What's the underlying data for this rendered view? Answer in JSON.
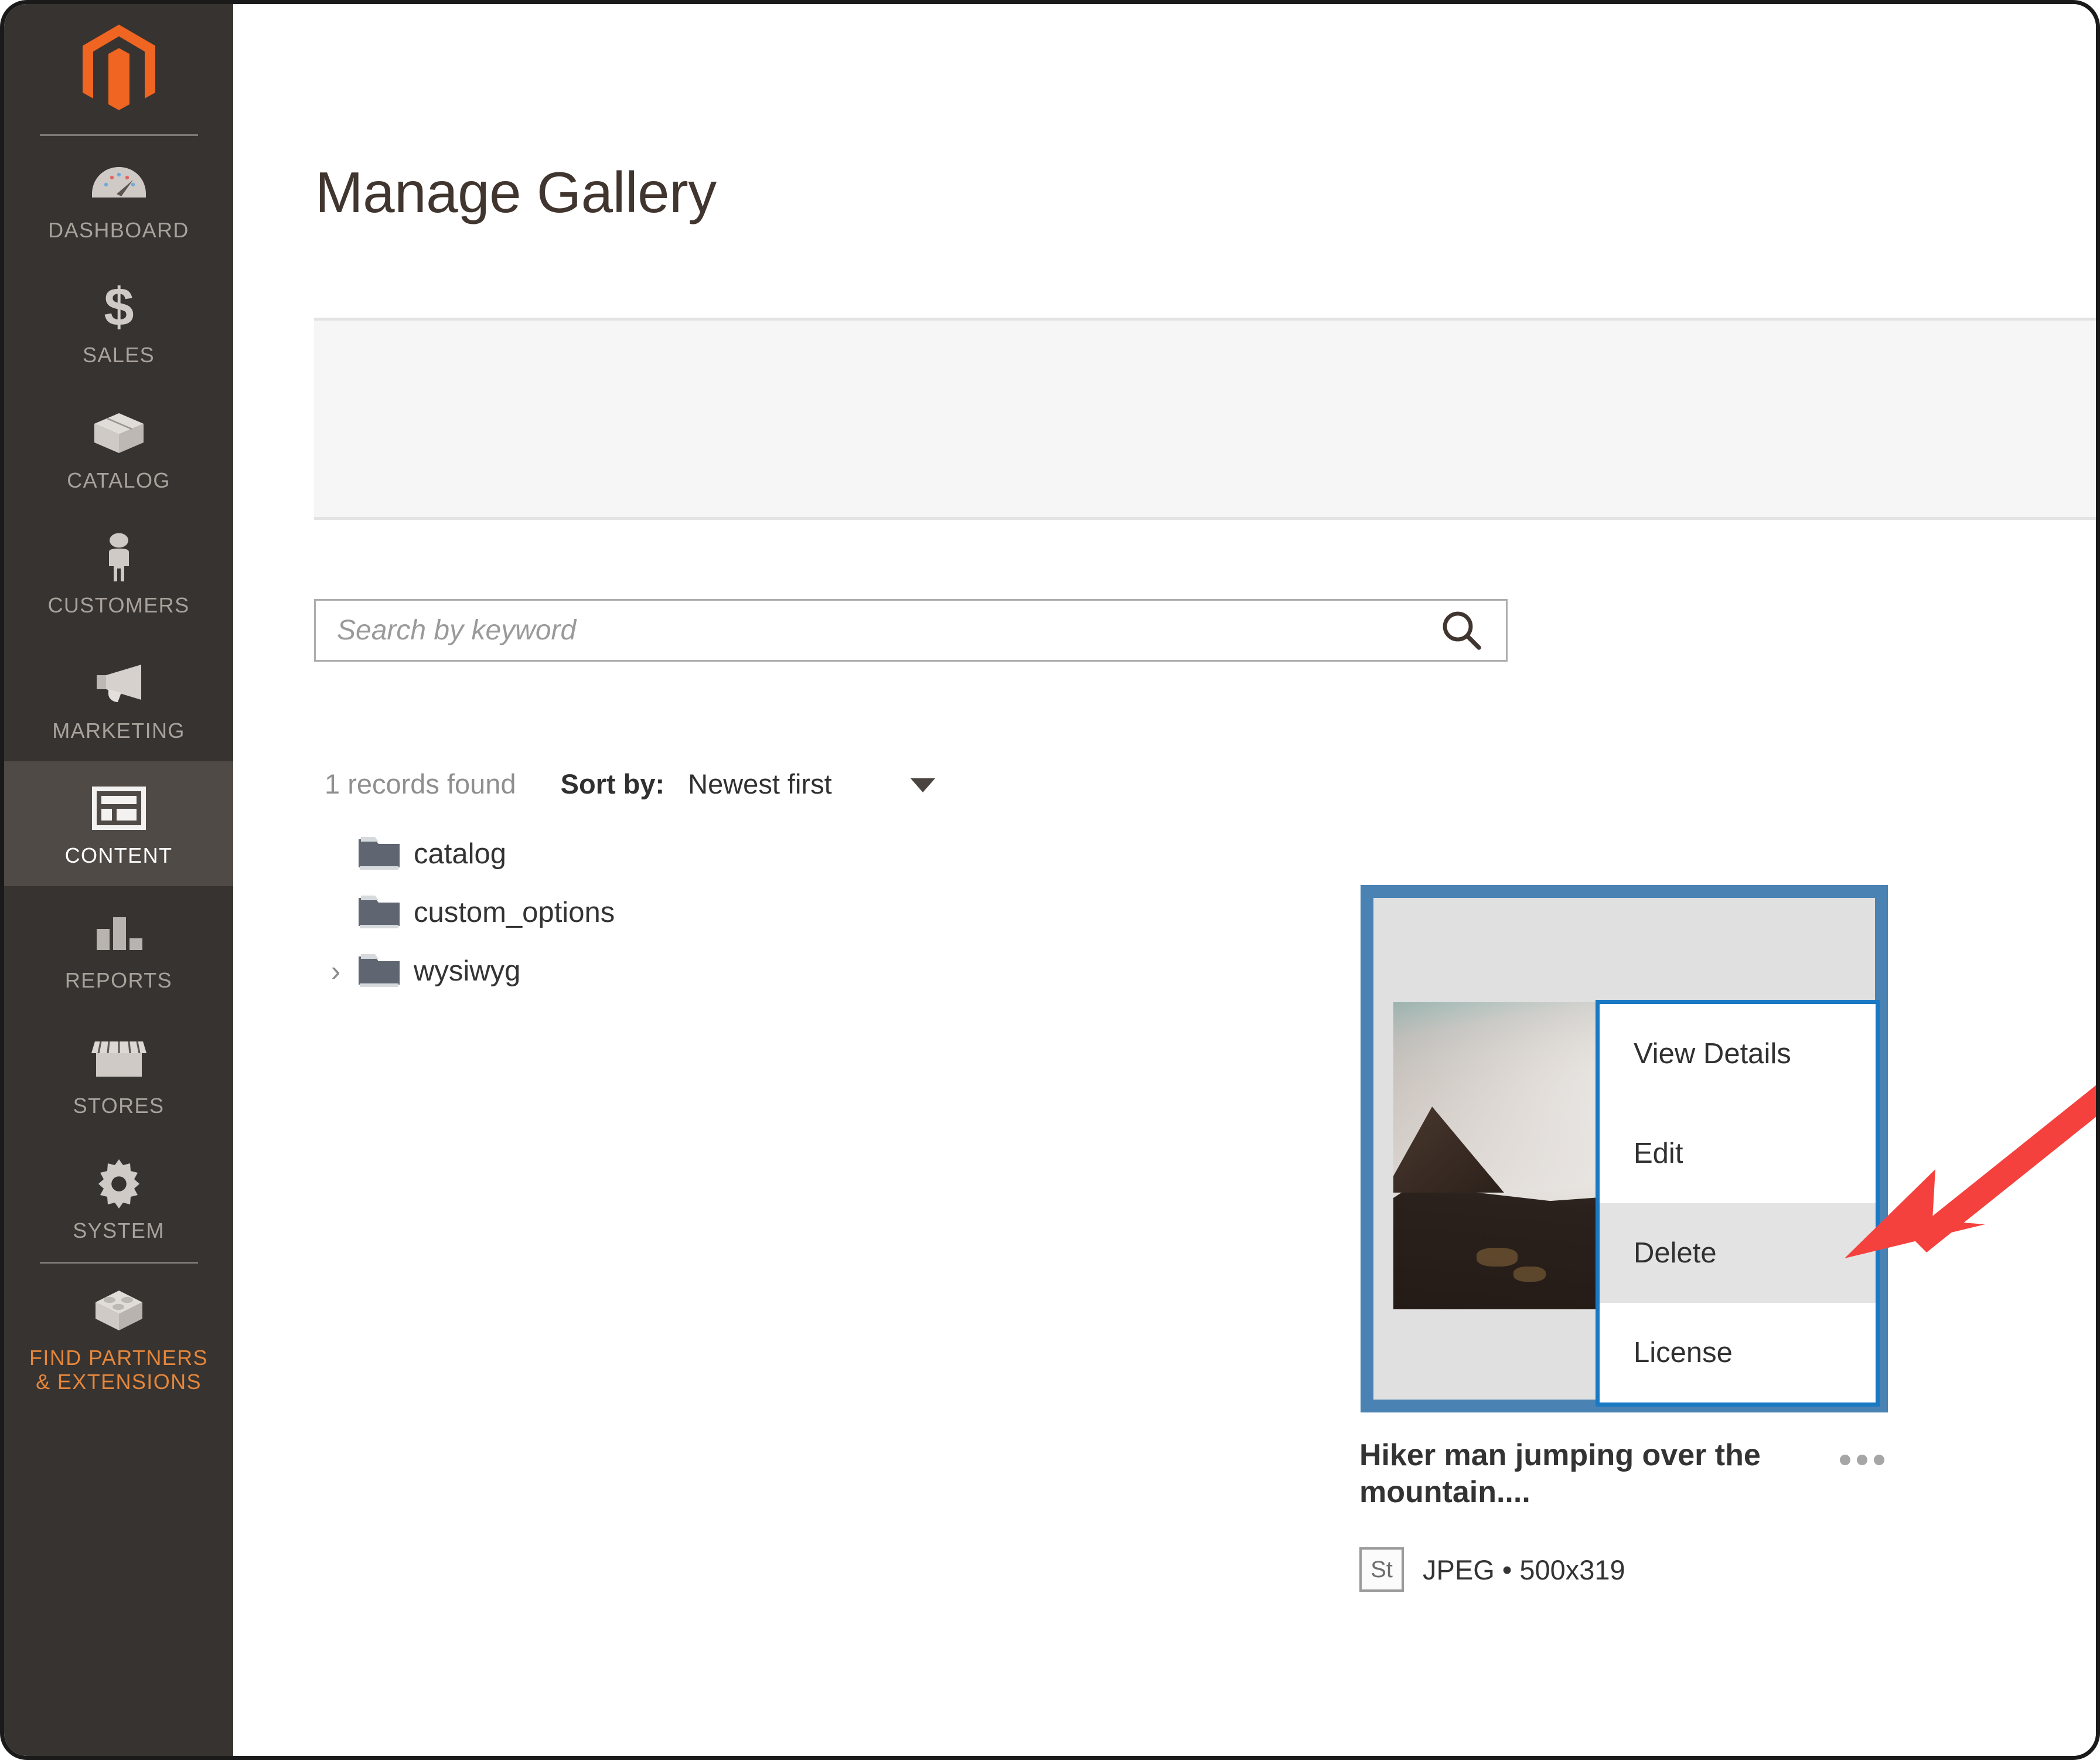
{
  "sidebar": {
    "logo_name": "magento-logo",
    "items": [
      {
        "label": "DASHBOARD",
        "icon": "gauge-icon",
        "active": false
      },
      {
        "label": "SALES",
        "icon": "dollar-icon",
        "active": false
      },
      {
        "label": "CATALOG",
        "icon": "box-icon",
        "active": false
      },
      {
        "label": "CUSTOMERS",
        "icon": "person-icon",
        "active": false
      },
      {
        "label": "MARKETING",
        "icon": "megaphone-icon",
        "active": false
      },
      {
        "label": "CONTENT",
        "icon": "layout-icon",
        "active": true
      },
      {
        "label": "REPORTS",
        "icon": "bar-chart-icon",
        "active": false
      },
      {
        "label": "STORES",
        "icon": "storefront-icon",
        "active": false
      },
      {
        "label": "SYSTEM",
        "icon": "gear-icon",
        "active": false
      },
      {
        "label": "FIND PARTNERS\n& EXTENSIONS",
        "icon": "brick-icon",
        "active": false
      }
    ]
  },
  "header": {
    "title": "Manage Gallery"
  },
  "search": {
    "placeholder": "Search by keyword",
    "value": "",
    "icon": "search-icon"
  },
  "toolbar": {
    "records_found": "1 records found",
    "sort_label": "Sort by:",
    "sort_value": "Newest first",
    "sort_options": [
      "Newest first"
    ]
  },
  "folder_tree": [
    {
      "label": "catalog",
      "expandable": false
    },
    {
      "label": "custom_options",
      "expandable": false
    },
    {
      "label": "wysiwyg",
      "expandable": true
    }
  ],
  "asset_card": {
    "title": "Hiker man jumping over the mountain....",
    "badge": "St",
    "meta": "JPEG • 500x319",
    "file_type": "JPEG",
    "dimensions": "500x319",
    "selected": true,
    "kebab_icon": "ellipsis-icon"
  },
  "context_menu": {
    "items": [
      {
        "label": "View Details",
        "highlighted": false
      },
      {
        "label": "Edit",
        "highlighted": false
      },
      {
        "label": "Delete",
        "highlighted": true
      },
      {
        "label": "License",
        "highlighted": false
      }
    ]
  },
  "annotation": {
    "type": "arrow",
    "color": "#f4413e",
    "points_to": "Delete"
  },
  "colors": {
    "sidebar_bg": "#373330",
    "sidebar_active_bg": "#4f4a46",
    "brand_orange": "#ef6521",
    "accent_blue": "#1979c3",
    "card_border_blue": "#4a82b4",
    "annotation_red": "#f4413e",
    "panel_grey": "#f6f6f6"
  }
}
